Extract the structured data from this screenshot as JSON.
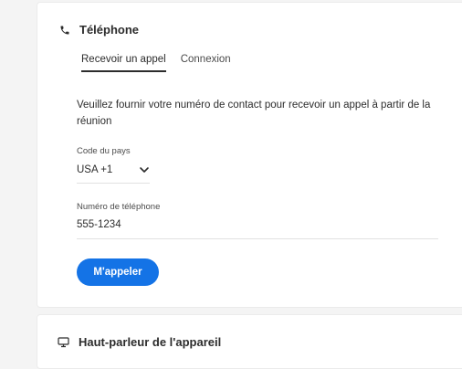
{
  "phone_section": {
    "icon": "phone-icon",
    "title": "Téléphone",
    "tabs": [
      {
        "label": "Recevoir un appel",
        "active": true
      },
      {
        "label": "Connexion",
        "active": false
      }
    ],
    "description": "Veuillez fournir votre numéro de contact pour recevoir un appel à partir de la réunion",
    "country_code": {
      "label": "Code du pays",
      "value": "USA +1",
      "icon": "chevron-down-icon"
    },
    "phone_number": {
      "label": "Numéro de téléphone",
      "value": "555-1234"
    },
    "call_button_label": "M'appeler"
  },
  "speaker_section": {
    "icon": "monitor-icon",
    "title": "Haut-parleur de l'appareil"
  },
  "colors": {
    "accent": "#1473e6",
    "background": "#f4f4f4",
    "card": "#ffffff",
    "text": "#2c2c2c"
  }
}
